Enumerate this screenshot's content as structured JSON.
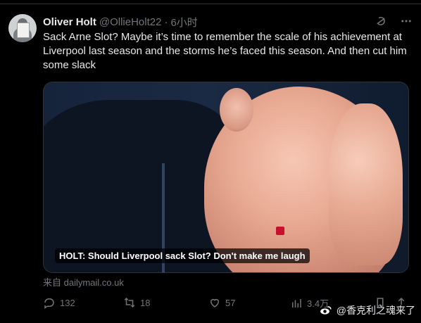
{
  "author": {
    "name": "Oliver Holt",
    "handle": "@OllieHolt22",
    "separator": "·",
    "time": "6小时"
  },
  "tweet": {
    "text": "Sack Arne Slot? Maybe it’s time to remember the scale of his achievement at Liverpool last season and the storms he’s faced this season. And then cut him some slack"
  },
  "media": {
    "caption": "HOLT: Should Liverpool sack Slot? Don't make me laugh"
  },
  "source": {
    "text": "来自 dailymail.co.uk"
  },
  "actions": {
    "replies": "132",
    "retweets": "18",
    "likes": "57",
    "views": "3.4万"
  },
  "icons": {
    "header": [
      "grok-icon",
      "more-icon"
    ],
    "actions": [
      "reply-icon",
      "retweet-icon",
      "like-icon",
      "views-icon",
      "bookmark-icon",
      "share-icon"
    ]
  },
  "watermark": {
    "text": "@香克利之魂来了",
    "logo": "weibo-logo"
  },
  "colors": {
    "background": "#000000",
    "text": "#e7e9ea",
    "muted": "#71767b",
    "accent": "#c8102e"
  }
}
